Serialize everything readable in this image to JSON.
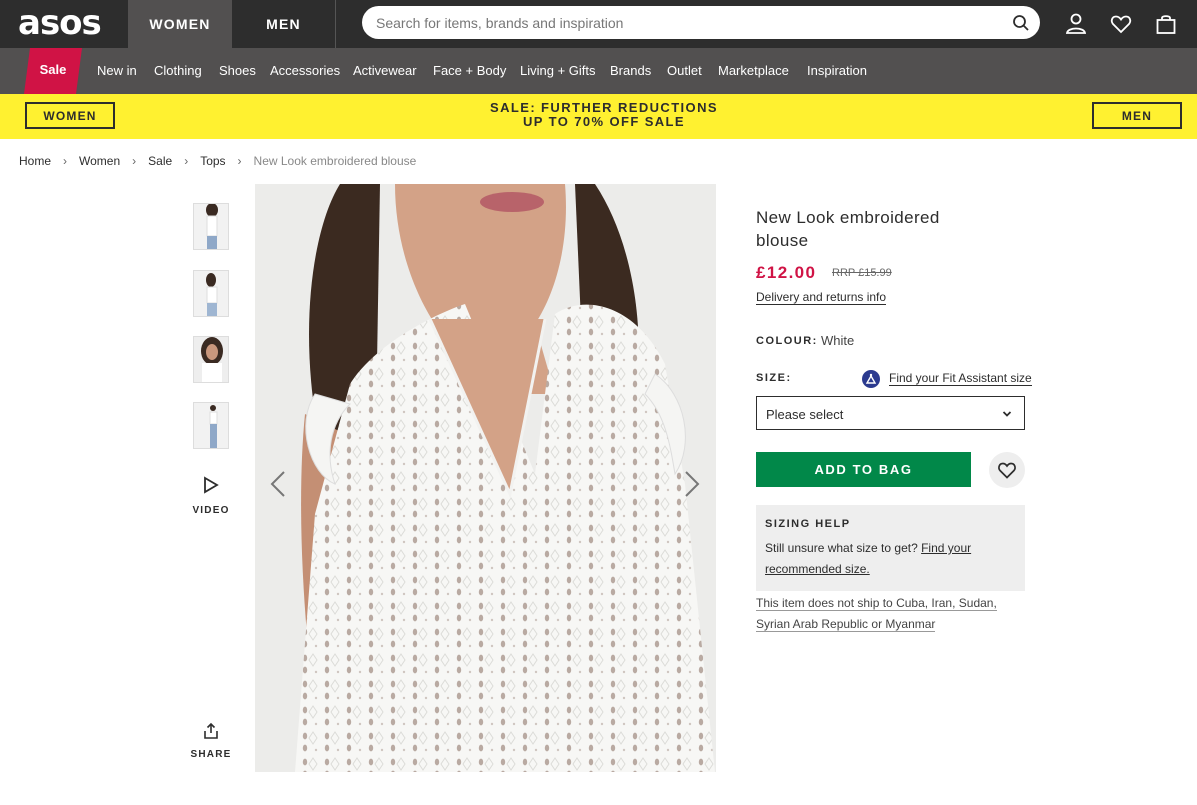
{
  "header": {
    "logo": "asos",
    "women_tab": "WOMEN",
    "men_tab": "MEN",
    "search_placeholder": "Search for items, brands and inspiration"
  },
  "nav": {
    "sale": "Sale",
    "items": [
      "New in",
      "Clothing",
      "Shoes",
      "Accessories",
      "Activewear",
      "Face + Body",
      "Living + Gifts",
      "Brands",
      "Outlet",
      "Marketplace",
      "Inspiration"
    ]
  },
  "promo": {
    "left_button": "WOMEN",
    "right_button": "MEN",
    "line1": "SALE: FURTHER REDUCTIONS",
    "line2": "UP TO 70% OFF SALE",
    "background": "#fff130"
  },
  "breadcrumb": [
    "Home",
    "Women",
    "Sale",
    "Tops",
    "New Look embroidered blouse"
  ],
  "gallery": {
    "video_label": "VIDEO",
    "share_label": "SHARE"
  },
  "product": {
    "title": "New Look embroidered blouse",
    "price": "£12.00",
    "rrp": "RRP £15.99",
    "delivery_link": "Delivery and returns info",
    "colour_label": "COLOUR:",
    "colour_value": "White",
    "size_label": "SIZE:",
    "fit_link": "Find your Fit Assistant size",
    "size_select_value": "Please select",
    "add_to_bag": "ADD TO BAG",
    "sizing_help_title": "SIZING HELP",
    "sizing_help_text": "Still unsure what size to get?",
    "sizing_help_link": "Find your recommended size.",
    "shipping_note": "This item does not ship to Cuba, Iran, Sudan, Syrian Arab Republic or Myanmar"
  },
  "colors": {
    "header_bg": "#2d2d2d",
    "nav_bg": "#525050",
    "sale_red": "#d01345",
    "add_to_bag_green": "#018849"
  }
}
